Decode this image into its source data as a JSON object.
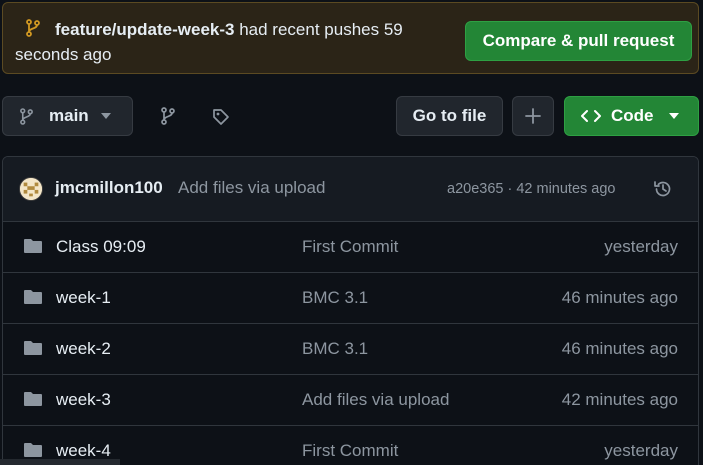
{
  "banner": {
    "branch_name": "feature/update-week-3",
    "message": " had recent pushes 59 seconds ago",
    "compare_button": "Compare & pull request"
  },
  "toolbar": {
    "branch_label": "main",
    "goto_file": "Go to file",
    "code_label": "Code"
  },
  "commit": {
    "author": "jmcmillon100",
    "message": "Add files via upload",
    "meta": "a20e365 · 42 minutes ago"
  },
  "files": [
    {
      "name": "Class 09:09",
      "message": "First Commit",
      "time": "yesterday"
    },
    {
      "name": "week-1",
      "message": "BMC 3.1",
      "time": "46 minutes ago"
    },
    {
      "name": "week-2",
      "message": "BMC 3.1",
      "time": "46 minutes ago"
    },
    {
      "name": "week-3",
      "message": "Add files via upload",
      "time": "42 minutes ago"
    },
    {
      "name": "week-4",
      "message": "First Commit",
      "time": "yesterday"
    }
  ],
  "colors": {
    "background": "#0d1117",
    "accent_green": "#238636",
    "banner_bg": "#2b2417",
    "muted_text": "#8d96a0",
    "folder_icon": "#8d96a0"
  },
  "icons": {
    "banner": "git-branch-icon",
    "branch_button": "git-branch-icon",
    "branches": "git-branch-icon",
    "tags": "tag-icon",
    "add": "plus-icon",
    "code": "code-icon",
    "history": "history-icon",
    "folder": "folder-icon"
  }
}
